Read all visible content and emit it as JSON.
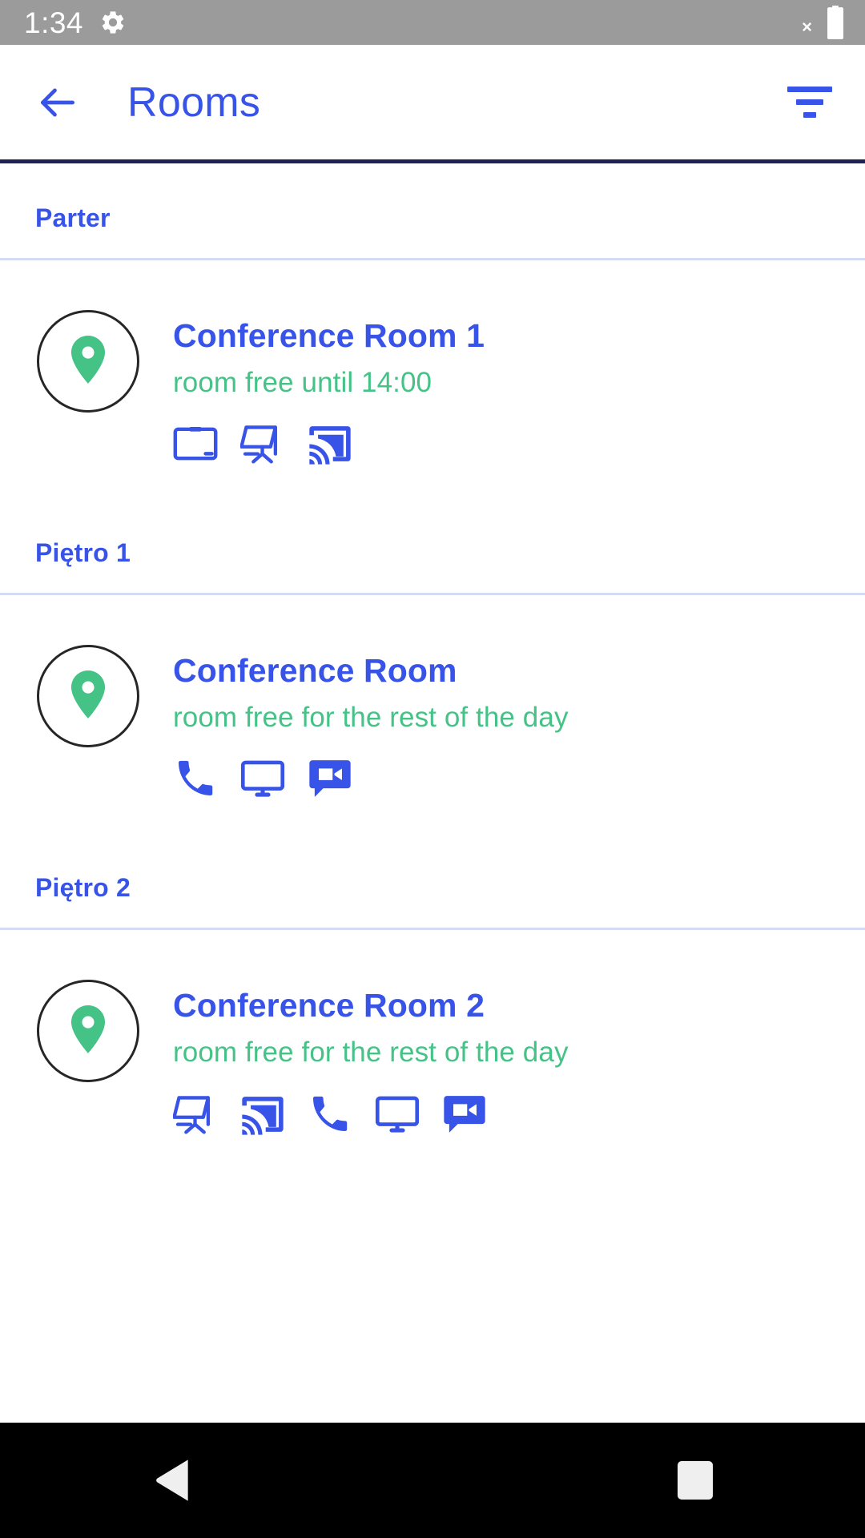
{
  "status_bar": {
    "clock": "1:34",
    "gear_icon": "gear-icon",
    "close_marker": "×",
    "battery_icon": "battery-icon"
  },
  "app_bar": {
    "back_icon": "back-arrow-icon",
    "title": "Rooms",
    "filter_icon": "filter-icon"
  },
  "colors": {
    "accent_blue": "#3853e8",
    "status_green": "#45c387",
    "app_bar_underline": "#1e2259",
    "divider": "#d5daf5",
    "status_bar_bg": "#9b9b9b",
    "nav_bar_bg": "#000000"
  },
  "sections": [
    {
      "header": "Parter",
      "rooms": [
        {
          "pin_icon": "map-pin-icon",
          "title": "Conference Room 1",
          "status": "room free until 14:00",
          "amenities": [
            "whiteboard-icon",
            "flipchart-icon",
            "cast-icon"
          ]
        }
      ]
    },
    {
      "header": "Piętro 1",
      "rooms": [
        {
          "pin_icon": "map-pin-icon",
          "title": "Conference Room",
          "status": "room free for the rest of the day",
          "amenities": [
            "phone-icon",
            "display-icon",
            "video-chat-icon"
          ]
        }
      ]
    },
    {
      "header": "Piętro 2",
      "rooms": [
        {
          "pin_icon": "map-pin-icon",
          "title": "Conference Room 2",
          "status": "room free for the rest of the day",
          "amenities": [
            "flipchart-icon",
            "cast-icon",
            "phone-icon",
            "display-icon",
            "video-chat-icon"
          ]
        }
      ]
    }
  ],
  "nav_bar": {
    "back_icon": "nav-back-icon",
    "recents_icon": "nav-recents-icon"
  }
}
